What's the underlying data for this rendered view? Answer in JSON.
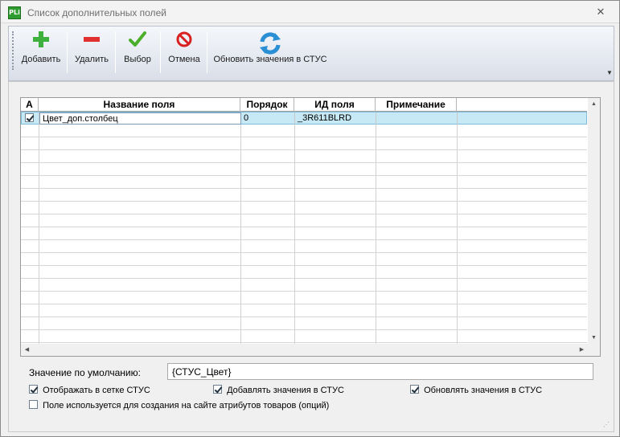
{
  "window": {
    "title": "Список дополнительных полей",
    "icon": "PLi",
    "close": "✕"
  },
  "toolbar": {
    "add": "Добавить",
    "delete": "Удалить",
    "select": "Выбор",
    "cancel": "Отмена",
    "refresh": "Обновить значения в СТУС"
  },
  "grid": {
    "columns": [
      "А",
      "Название поля",
      "Порядок",
      "ИД поля",
      "Примечание"
    ],
    "rows": [
      {
        "active": true,
        "name": "Цвет_доп.столбец",
        "order": "0",
        "id": "_3R611BLRD",
        "note": ""
      }
    ]
  },
  "default_value": {
    "label": "Значение по умолчанию:",
    "value": "{СТУС_Цвет}"
  },
  "options": {
    "show_in_grid": {
      "label": "Отображать в сетке СТУС",
      "checked": true
    },
    "add_values": {
      "label": "Добавлять значения в СТУС",
      "checked": true
    },
    "update_values": {
      "label": "Обновлять значения в СТУС",
      "checked": true
    },
    "site_attributes": {
      "label": "Поле используется для создания на сайте атрибутов товаров (опций)",
      "checked": false
    }
  },
  "colors": {
    "selected_row": "#c6e9f5",
    "add_icon": "#3db03d",
    "delete_icon": "#e03030",
    "select_icon": "#4caf2a",
    "cancel_icon": "#d92020",
    "refresh_icon": "#2a8fd4"
  }
}
